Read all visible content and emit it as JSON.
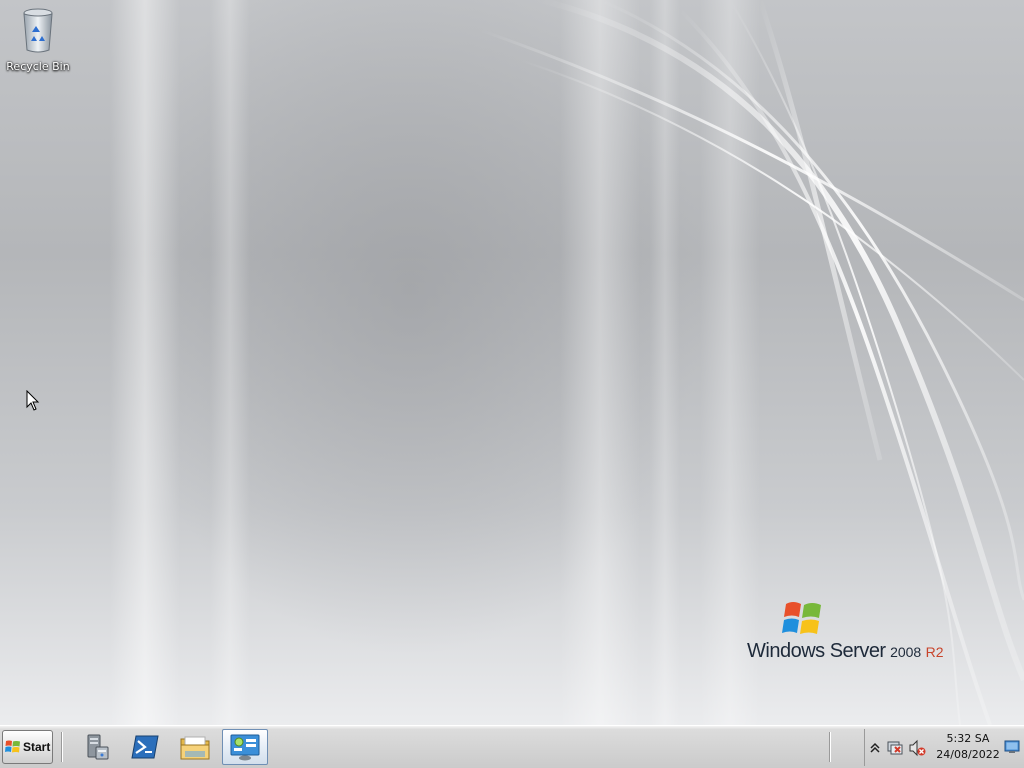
{
  "desktop": {
    "icons": [
      {
        "label": "Recycle Bin",
        "icon": "recycle-bin-icon"
      }
    ],
    "logo": {
      "brand": "Windows Server",
      "version": "2008",
      "edition": "R2"
    }
  },
  "taskbar": {
    "start_label": "Start",
    "pinned": [
      {
        "name": "server-manager",
        "icon": "server-manager-icon"
      },
      {
        "name": "powershell",
        "icon": "powershell-icon"
      },
      {
        "name": "windows-explorer",
        "icon": "folder-icon"
      },
      {
        "name": "control-panel",
        "icon": "control-panel-icon",
        "active": true
      }
    ],
    "tray": {
      "icons": [
        "show-hidden-icons-icon",
        "network-icon",
        "volume-muted-icon"
      ],
      "time": "5:32 SA",
      "date": "24/08/2022"
    }
  },
  "colors": {
    "taskbar": "#d4d4d4",
    "logo_accent": "#c8452c",
    "desktop_base": "#b4b6b9"
  }
}
